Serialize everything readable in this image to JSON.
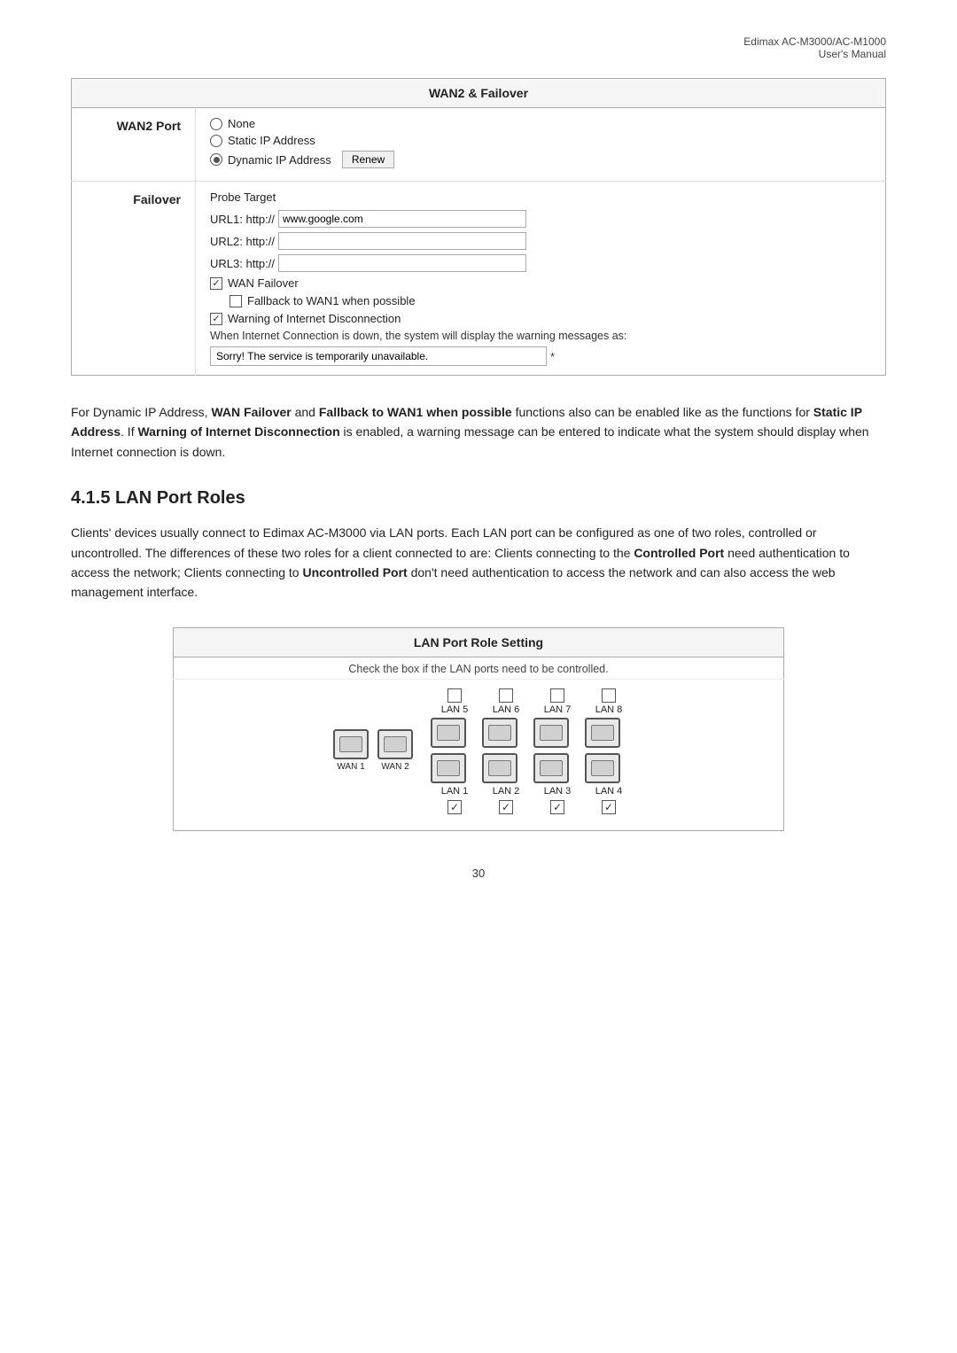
{
  "header": {
    "line1": "Edimax  AC-M3000/AC-M1000",
    "line2": "User's  Manual"
  },
  "wan2_table": {
    "title": "WAN2 & Failover",
    "wan2_port_label": "WAN2 Port",
    "wan2_options": [
      {
        "label": "None",
        "selected": false
      },
      {
        "label": "Static IP Address",
        "selected": false
      },
      {
        "label": "Dynamic IP Address",
        "selected": true
      }
    ],
    "renew_button": "Renew",
    "failover_label": "Failover",
    "probe_target": "Probe Target",
    "url1_prefix": "URL1: http://",
    "url1_value": "www.google.com",
    "url2_prefix": "URL2: http://",
    "url2_value": "",
    "url3_prefix": "URL3: http://",
    "url3_value": "",
    "wan_failover_label": "WAN Failover",
    "wan_failover_checked": true,
    "fallback_label": "Fallback to WAN1 when possible",
    "fallback_checked": false,
    "warning_label": "Warning of Internet Disconnection",
    "warning_checked": true,
    "warning_desc": "When Internet Connection is down, the system will display the warning messages as:",
    "warning_message": "Sorry! The service is temporarily unavailable.",
    "asterisk": "*"
  },
  "body_paragraph": {
    "text_before_bold1": "For Dynamic IP Address, ",
    "bold1": "WAN Failover",
    "text_between1": " and ",
    "bold2": "Fallback to WAN1 when possible",
    "text_between2": " functions also can be enabled like as the functions for ",
    "bold3": "Static IP Address",
    "text_between3": ". If ",
    "bold4": "Warning of Internet Disconnection",
    "text_after": " is enabled, a warning message can be entered to indicate what the system should display when Internet connection is down."
  },
  "section": {
    "heading": "4.1.5 LAN Port Roles",
    "intro": "Clients' devices usually connect to Edimax AC-M3000 via LAN ports. Each LAN port can be configured as one of two roles, controlled or uncontrolled. The differences of these two roles for a client connected to are: Clients connecting to the ",
    "bold1": "Controlled Port",
    "mid1": " need authentication to access the network; Clients connecting to ",
    "bold2": "Uncontrolled Port",
    "end": " don't need authentication to access the network and can also access the web management interface."
  },
  "lan_table": {
    "title": "LAN Port Role Setting",
    "subtitle": "Check the box if the LAN ports need to be controlled.",
    "top_labels": [
      "LAN 5",
      "LAN 6",
      "LAN 7",
      "LAN 8"
    ],
    "bottom_labels": [
      "LAN 1",
      "LAN 2",
      "LAN 3",
      "LAN 4"
    ],
    "wan_labels": [
      "WAN 1",
      "WAN 2"
    ],
    "bottom_checkboxes": [
      true,
      true,
      true,
      true
    ]
  },
  "page_number": "30"
}
